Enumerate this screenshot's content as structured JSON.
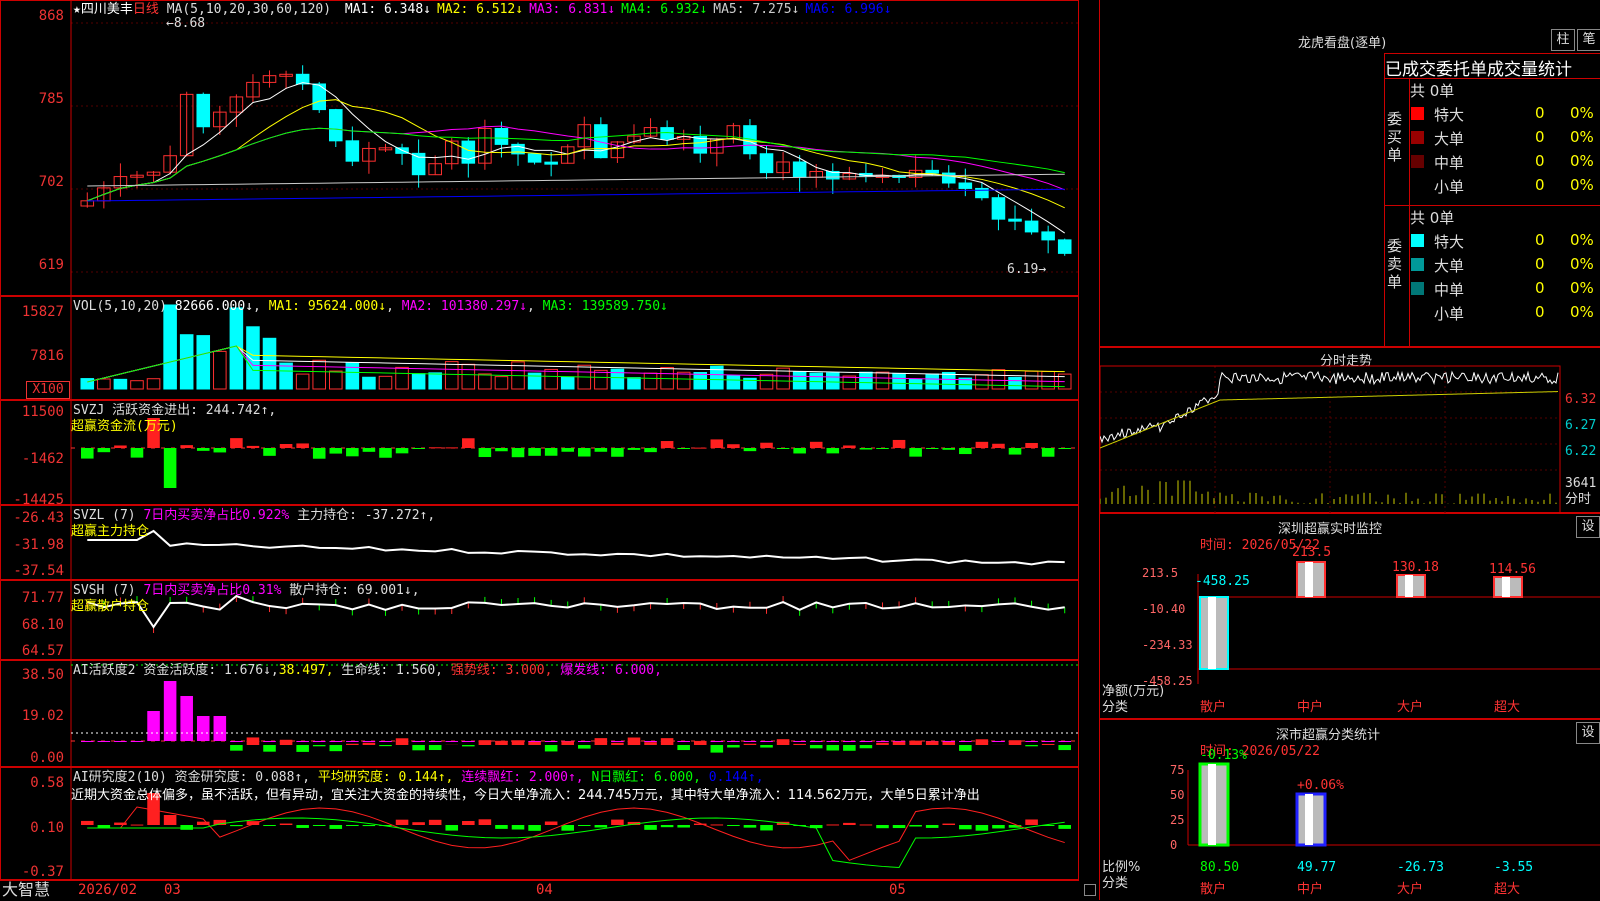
{
  "stock": {
    "star": "★",
    "name": "四川美丰",
    "period": "日线"
  },
  "main_header": {
    "ma_label": "MA(5,10,20,30,60,120)",
    "items": [
      {
        "text": "MA1: 6.348↓",
        "color": "#ffffff"
      },
      {
        "text": "MA2: 6.512↓",
        "color": "#ffff00"
      },
      {
        "text": "MA3: 6.831↓",
        "color": "#ff00ff"
      },
      {
        "text": "MA4: 6.932↓",
        "color": "#00ff00"
      },
      {
        "text": "MA5: 7.275↓",
        "color": "#cccccc"
      },
      {
        "text": "MA6: 6.996↓",
        "color": "#0000ff"
      }
    ]
  },
  "price_axis": [
    "868",
    "785",
    "702",
    "619"
  ],
  "price_annotations": {
    "high": "8.68",
    "low": "6.19"
  },
  "vol": {
    "label": "VOL(5,10,20)",
    "value": "82666.000↓",
    "ma1": "MA1: 95624.000↓",
    "ma2": "MA2: 101380.297↓",
    "ma3": "MA3: 139589.750↓",
    "axis": [
      "15827",
      "7816"
    ],
    "unit": "X100"
  },
  "svzj": {
    "label": "SVZJ",
    "title": "活跃资金进出: 244.742↑",
    "subtitle": "超赢资金流(万元)",
    "axis": [
      "11500",
      "-1462",
      "-14425"
    ]
  },
  "svzl": {
    "label": "SVZL (7)",
    "ratio": "7日内买卖净占比0.922%",
    "pos": "主力持仓: -37.272↑,",
    "subtitle": "超赢主力持仓",
    "axis": [
      "-26.43",
      "-31.98",
      "-37.54"
    ]
  },
  "svsh": {
    "label": "SVSH (7)",
    "ratio": "7日内买卖净占比0.31%",
    "pos": "散户持仓: 69.001↓,",
    "subtitle": "超赢散户持仓",
    "axis": [
      "71.77",
      "68.10",
      "64.57"
    ]
  },
  "ai1": {
    "label": "AI活跃度2",
    "l1": "资金活跃度: 1.676↓,",
    "l2": "38.497,",
    "l3": "生命线: 1.560,",
    "l4": "强势线: 3.000,",
    "l5": "爆发线: 6.000,",
    "axis": [
      "38.50",
      "19.02",
      "0.00"
    ]
  },
  "ai2": {
    "label": "AI研究度2(10)",
    "l1": "资金研究度: 0.088↑,",
    "l2": "平均研究度: 0.144↑,",
    "l3": "连续飘红: 2.000↑,",
    "l4": "N日飘红: 6.000,",
    "l5": "0.144↑,",
    "note": "近期大资金总体偏多，虽不活跃，但有异动，宜关注大资金的持续性，今日大单净流入：244.745万元，其中特大单净流入：114.562万元，大单5日累计净出",
    "axis": [
      "0.58",
      "0.10",
      "-0.37"
    ]
  },
  "xaxis": {
    "brand": "大智慧",
    "dates": [
      "2026/02",
      "03",
      "04",
      "05"
    ]
  },
  "dragon": {
    "title": "龙虎看盘(逐单)",
    "btn1": "柱",
    "btn2": "笔",
    "tabs": "已成交委托单成交量统计",
    "buy": {
      "side": "委买单",
      "total": "共 0单",
      "rows": [
        {
          "name": "特大",
          "n": "0",
          "p": "0%",
          "c": "#ff0000"
        },
        {
          "name": "大单",
          "n": "0",
          "p": "0%",
          "c": "#990000"
        },
        {
          "name": "中单",
          "n": "0",
          "p": "0%",
          "c": "#660000"
        },
        {
          "name": "小单",
          "n": "0",
          "p": "0%",
          "c": "#000000"
        }
      ]
    },
    "sell": {
      "side": "委卖单",
      "total": "共 0单",
      "rows": [
        {
          "name": "特大",
          "n": "0",
          "p": "0%",
          "c": "#00ffff"
        },
        {
          "name": "大单",
          "n": "0",
          "p": "0%",
          "c": "#009999"
        },
        {
          "name": "中单",
          "n": "0",
          "p": "0%",
          "c": "#007777"
        },
        {
          "name": "小单",
          "n": "0",
          "p": "0%",
          "c": "#000000"
        }
      ]
    }
  },
  "intraday": {
    "title": "分时走势",
    "axis": [
      "6.32",
      "6.27",
      "6.22"
    ],
    "vol": "3641",
    "vol_label": "分时"
  },
  "sz_monitor": {
    "title": "深圳超赢实时监控",
    "btn": "设",
    "time": "时间: 2026/05/22",
    "axis": [
      "213.5",
      "-10.40",
      "-234.33",
      "-458.25"
    ],
    "ylabel1": "净额(万元)",
    "ylabel2": "分类",
    "bars": [
      {
        "name": "散户",
        "value": "-458.25"
      },
      {
        "name": "中户",
        "value": "213.5"
      },
      {
        "name": "大户",
        "value": "130.18"
      },
      {
        "name": "超大",
        "value": "114.56"
      }
    ]
  },
  "sz_class": {
    "title": "深市超赢分类统计",
    "btn": "设",
    "time": "时间: 2026/05/22",
    "axis": [
      "75",
      "50",
      "25",
      "0"
    ],
    "ylabel1": "比例%",
    "ylabel2": "分类",
    "bars": [
      {
        "name": "散户",
        "value": "80.50",
        "top": "-0.13%"
      },
      {
        "name": "中户",
        "value": "49.77",
        "top": "+0.06%"
      },
      {
        "name": "大户",
        "value": "-26.73",
        "top": ""
      },
      {
        "name": "超大",
        "value": "-3.55",
        "top": ""
      }
    ]
  }
}
